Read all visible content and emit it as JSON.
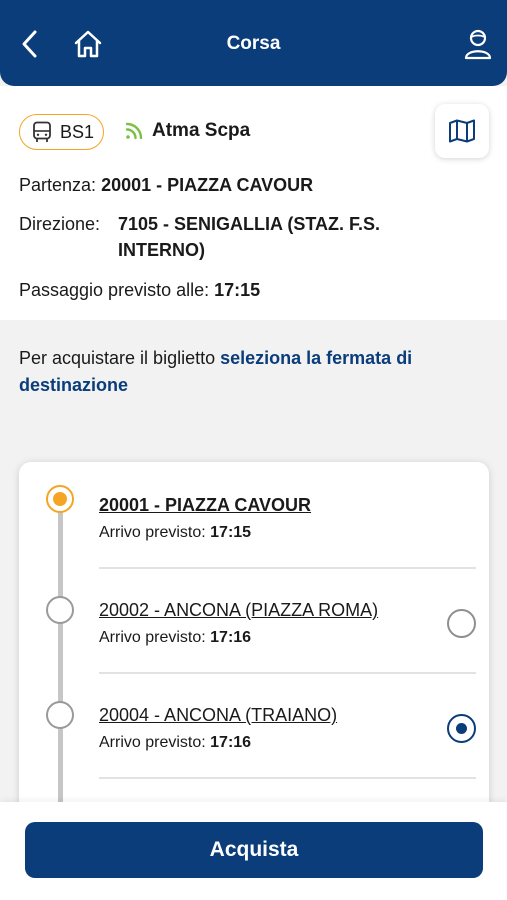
{
  "header": {
    "title": "Corsa",
    "icons": [
      "back-arrow-icon",
      "home-icon",
      "user-icon"
    ]
  },
  "trip": {
    "line": "BS1",
    "operator": "Atma Scpa",
    "departure_label": "Partenza:",
    "departure_value": "20001 - PIAZZA CAVOUR",
    "direction_label": "Direzione:",
    "direction_value": "7105 - SENIGALLIA (STAZ. F.S. INTERNO)",
    "passage_label": "Passaggio previsto alle:",
    "passage_value": "17:15"
  },
  "hint": {
    "text": "Per acquistare il biglietto ",
    "link": "seleziona la fermata di destinazione"
  },
  "stops": [
    {
      "name": "20001 - PIAZZA CAVOUR",
      "arrival_label": "Arrivo previsto:",
      "arrival_time": "17:15",
      "current": true,
      "selectable": false,
      "selected": false
    },
    {
      "name": "20002 - ANCONA (PIAZZA ROMA)",
      "arrival_label": "Arrivo previsto:",
      "arrival_time": "17:16",
      "current": false,
      "selectable": true,
      "selected": false
    },
    {
      "name": "20004 - ANCONA (TRAIANO)",
      "arrival_label": "Arrivo previsto:",
      "arrival_time": "17:16",
      "current": false,
      "selectable": true,
      "selected": true
    }
  ],
  "footer": {
    "buy_label": "Acquista"
  },
  "colors": {
    "primary": "#0a3d7a",
    "accent": "#f5a524",
    "realtime": "#7bc043"
  }
}
